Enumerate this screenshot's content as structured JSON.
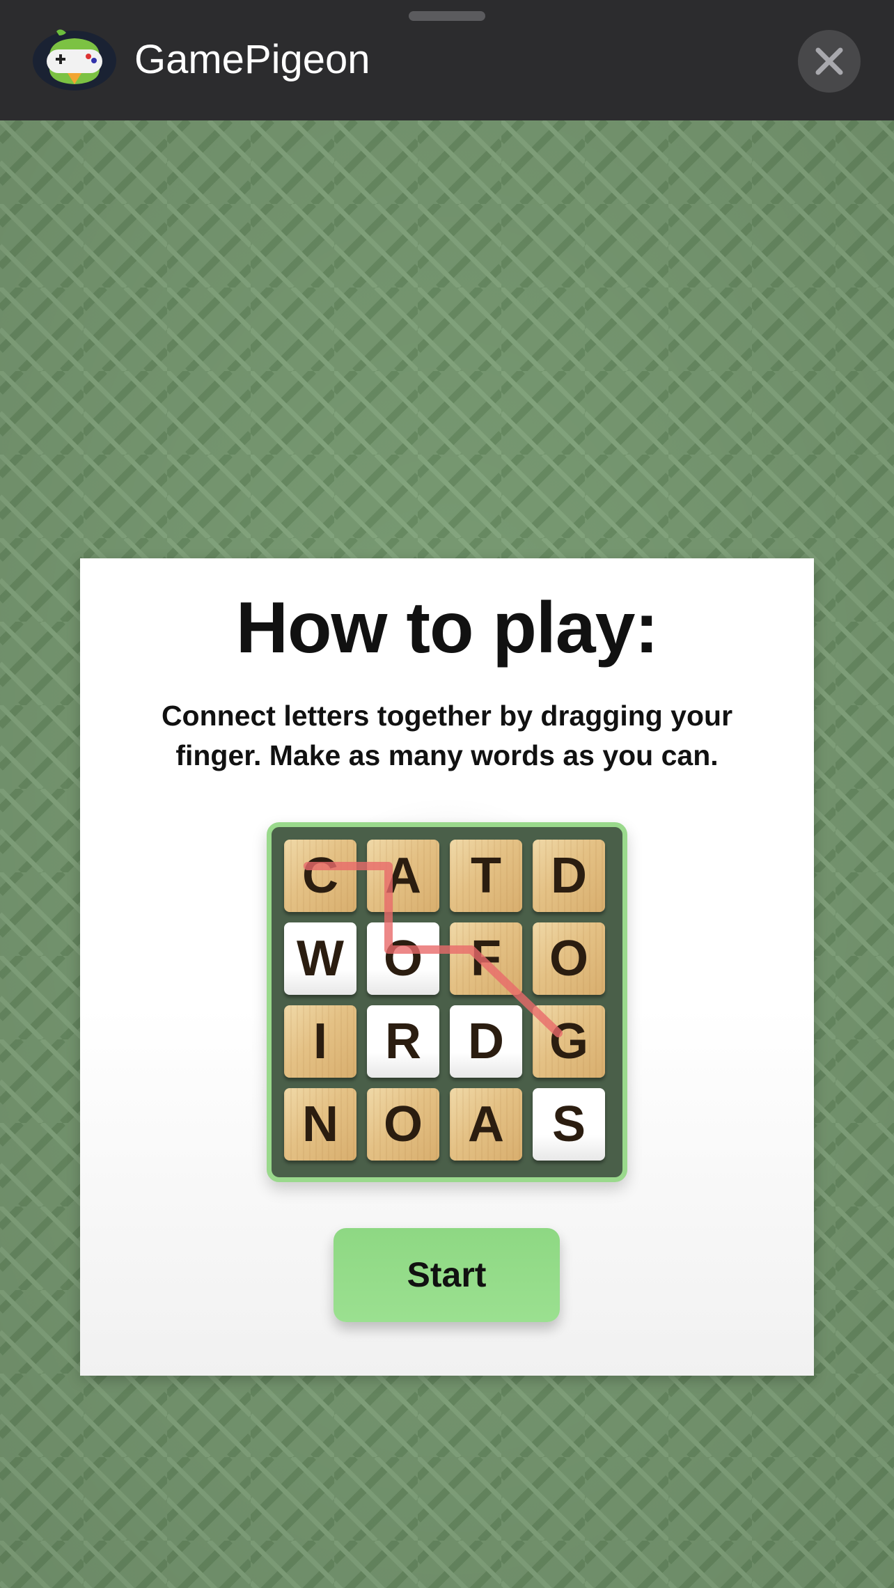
{
  "header": {
    "app_title": "GamePigeon",
    "icon": "gamepigeon-bird-icon",
    "close_icon": "close-icon"
  },
  "card": {
    "title": "How to play:",
    "description": "Connect letters together by dragging your finger. Make as many words as you can.",
    "board": {
      "rows": [
        [
          "C",
          "A",
          "T",
          "D"
        ],
        [
          "W",
          "O",
          "F",
          "O"
        ],
        [
          "I",
          "R",
          "D",
          "G"
        ],
        [
          "N",
          "O",
          "A",
          "S"
        ]
      ],
      "selected_path": [
        [
          1,
          0
        ],
        [
          1,
          1
        ],
        [
          2,
          1
        ],
        [
          2,
          2
        ],
        [
          3,
          3
        ]
      ],
      "path_color": "#e86a6a"
    },
    "start_label": "Start"
  },
  "colors": {
    "header_bg": "#2c2c2e",
    "background_green": "#7a9c74",
    "board_border": "#9ad98c",
    "start_button": "#98de8c"
  }
}
